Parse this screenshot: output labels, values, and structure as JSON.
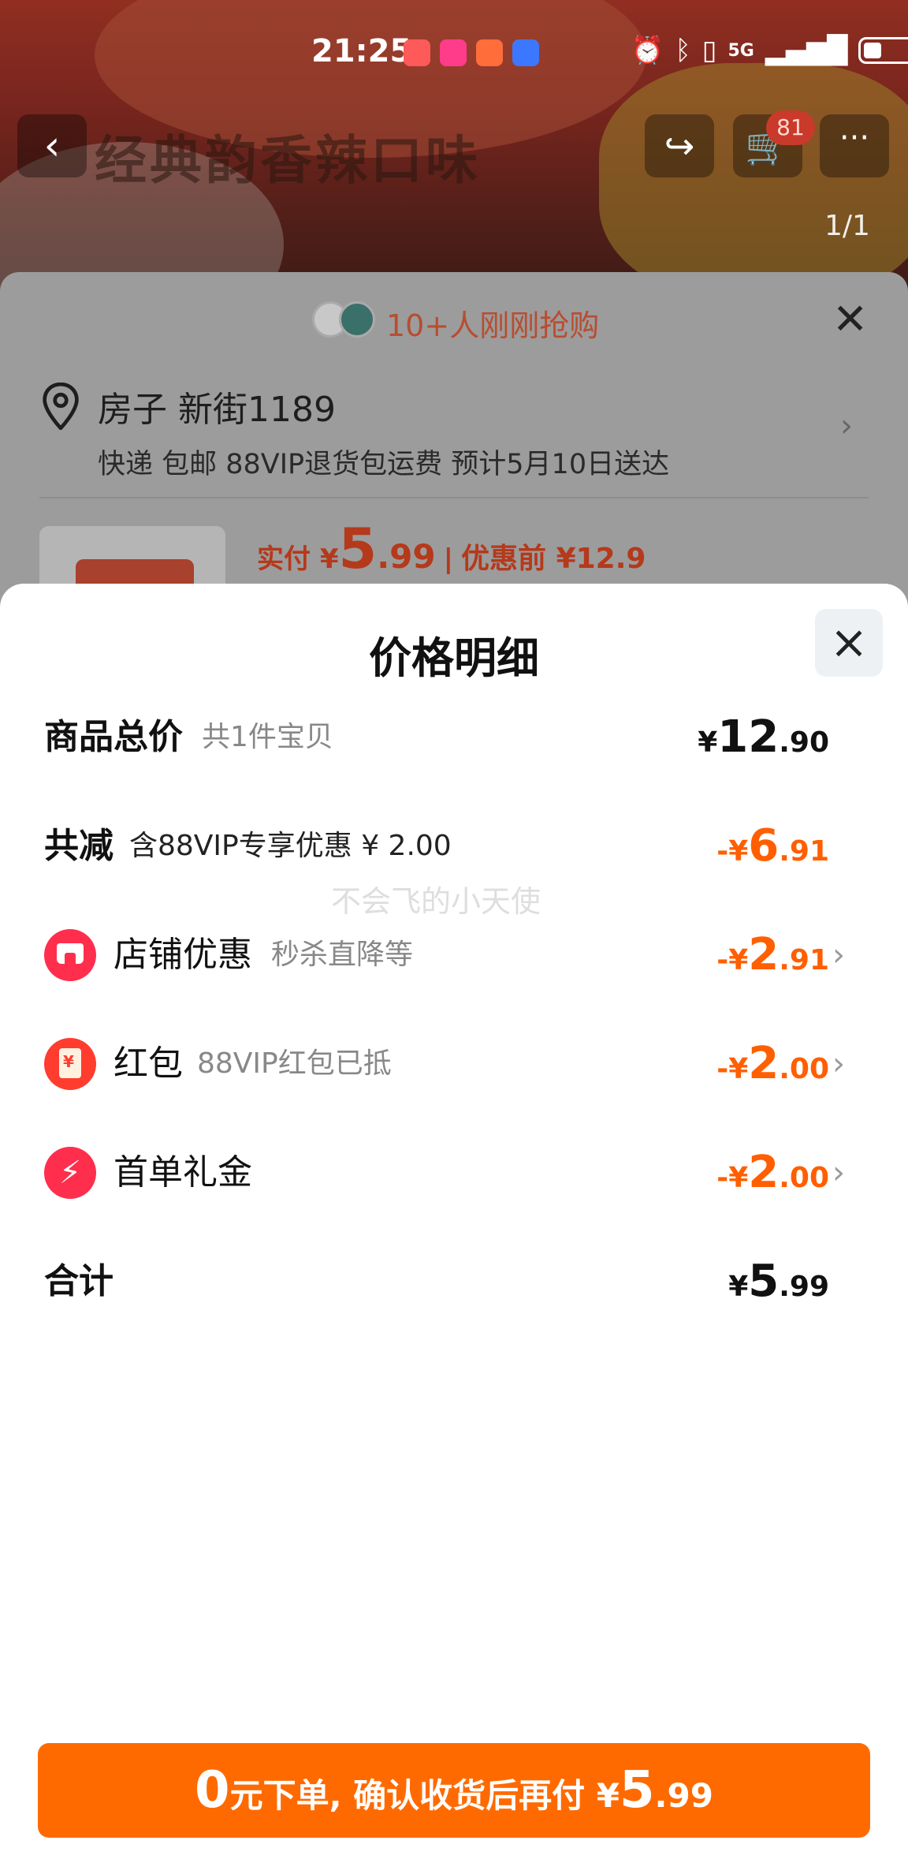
{
  "status_bar": {
    "time": "21:25",
    "network": "5G"
  },
  "product_page": {
    "banner_text": "经典韵香辣口味",
    "cart_count": "81",
    "image_counter": "1/1"
  },
  "order_sheet": {
    "buyers_text": "10+人刚刚抢购",
    "address_name": "房子 新街1189",
    "delivery_info": "快递 包邮 88VIP退货包运费 预计5月10日送达",
    "price_label": "实付 ¥",
    "price_int": "5",
    "price_dec": ".99",
    "price_before": "优惠前 ¥12.9"
  },
  "modal": {
    "title": "价格明细",
    "rows": {
      "total_goods": {
        "label": "商品总价",
        "sub": "共1件宝贝",
        "symbol": "¥",
        "int": "12",
        "dec": ".90"
      },
      "total_discount": {
        "label": "共减",
        "sub": "含88VIP专享优惠 ¥ 2.00",
        "symbol": "-¥",
        "int": "6",
        "dec": ".91"
      },
      "shop_discount": {
        "label": "店铺优惠",
        "sub": "秒杀直降等",
        "symbol": "-¥",
        "int": "2",
        "dec": ".91"
      },
      "red_packet": {
        "label": "红包",
        "sub": "88VIP红包已抵",
        "symbol": "-¥",
        "int": "2",
        "dec": ".00"
      },
      "first_order": {
        "label": "首单礼金",
        "symbol": "-¥",
        "int": "2",
        "dec": ".00"
      },
      "sum": {
        "label": "合计",
        "symbol": "¥",
        "int": "5",
        "dec": ".99"
      }
    },
    "watermark": "不会飞的小天使"
  },
  "cta": {
    "zero": "0",
    "text": "元下单, 确认收货后再付 ¥",
    "int": "5",
    "dec": ".99"
  },
  "colors": {
    "accent_orange": "#ff6a00",
    "discount_orange": "#ff5f00",
    "icon_red": "#ff2e4d"
  },
  "icons": [
    "back-icon",
    "share-icon",
    "cart-icon",
    "more-icon",
    "close-icon",
    "location-pin-icon",
    "chevron-right-icon",
    "shop-icon",
    "red-packet-icon",
    "lightning-icon"
  ]
}
